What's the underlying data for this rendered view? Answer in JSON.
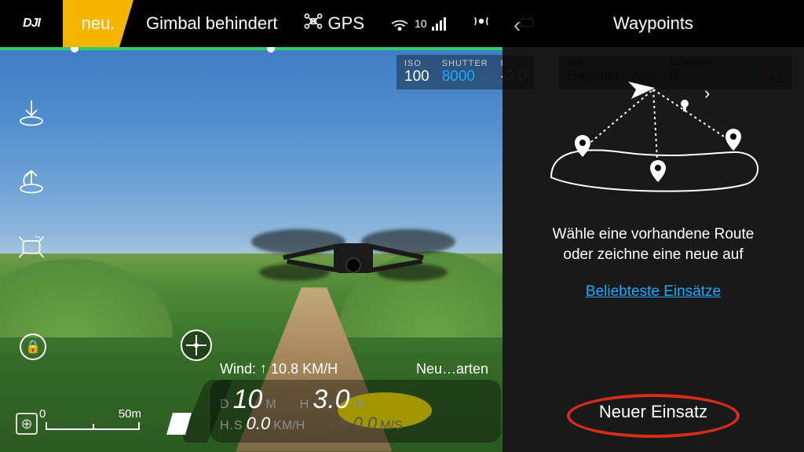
{
  "brand": "DJI",
  "top": {
    "tag": "neu.",
    "warning": "Gimbal behindert",
    "gps_label": "GPS",
    "sat_count": "10"
  },
  "camera": {
    "iso_label": "ISO",
    "iso_value": "100",
    "shutter_label": "SHUTTER",
    "shutter_value": "8000",
    "ev_label": "EV",
    "ev_value": "-2.0",
    "wb_label": "WB",
    "wb_value": "Bewölkt",
    "mode_label": "",
    "mode_value": "N/A",
    "capacity_label": "CAPACITY",
    "capacity_value": "0",
    "ae_label": "AE"
  },
  "hud": {
    "wind_label": "Wind:",
    "wind_value": "10.8 KM/H",
    "neu": "Neu…arten",
    "d_label": "D",
    "d_value": "10",
    "d_unit": "M",
    "h_label": "H",
    "h_value": "3.0",
    "h_unit": "M",
    "hs_label": "H.S",
    "hs_value": "0.0",
    "hs_unit": "KM/H",
    "vs_label": "V.S",
    "vs_value": "0.0",
    "vs_unit": "M/S"
  },
  "scale": {
    "zero": "0",
    "fifty": "50m"
  },
  "panel": {
    "title": "Waypoints",
    "message_line1": "Wähle eine vorhandene Route",
    "message_line2": "oder zeichne eine neue auf",
    "link": "Beliebteste Einsätze",
    "new_button": "Neuer Einsatz"
  }
}
